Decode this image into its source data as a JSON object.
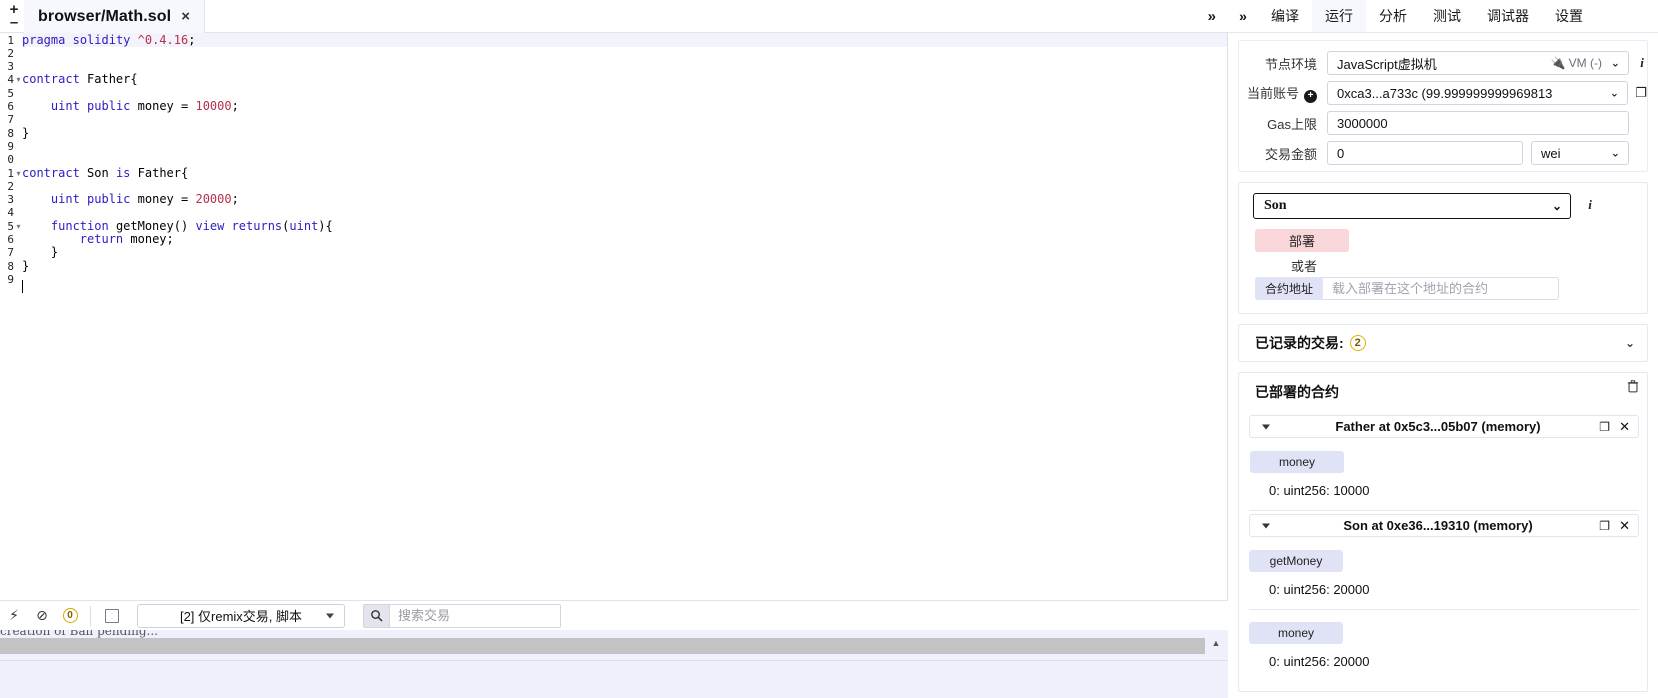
{
  "editor": {
    "tab_title": "browser/Math.sol",
    "tab_close": "×",
    "add_icon": "+",
    "minus_icon": "–",
    "expand_icon": "»",
    "line_numbers": [
      "1",
      "2",
      "3",
      "4",
      "5",
      "6",
      "7",
      "8",
      "9",
      "0",
      "1",
      "2",
      "3",
      "4",
      "5",
      "6",
      "7",
      "8",
      "9"
    ],
    "code_lines": [
      "pragma solidity ^0.4.16;",
      "",
      "",
      "contract Father{",
      "",
      "    uint public money = 10000;",
      "",
      "}",
      "",
      "",
      "contract Son is Father{",
      "",
      "    uint public money = 20000;",
      "",
      "    function getMoney() view returns(uint){",
      "        return money;",
      "    }",
      "}",
      ""
    ]
  },
  "bottom_toolbar": {
    "error_count": "0",
    "filter_label": "[2] 仅remix交易, 脚本",
    "search_placeholder": "搜索交易",
    "search_value": "",
    "checkbox_checked": false,
    "terminal_text": "creation of Ball pending..."
  },
  "right_panel": {
    "tabs": [
      {
        "label": "编译",
        "active": false
      },
      {
        "label": "运行",
        "active": true
      },
      {
        "label": "分析",
        "active": false
      },
      {
        "label": "测试",
        "active": false
      },
      {
        "label": "调试器",
        "active": false
      },
      {
        "label": "设置",
        "active": false
      }
    ],
    "expand_icon": "»",
    "environment": {
      "label": "节点环境",
      "value": "JavaScript虚拟机",
      "vm_tag": "VM (-)",
      "info_icon": "i"
    },
    "account": {
      "label": "当前账号",
      "value": "0xca3...a733c (99.999999999969813 ",
      "plus_icon": "+",
      "copy_icon": "❐"
    },
    "gas_limit": {
      "label": "Gas上限",
      "value": "3000000"
    },
    "value": {
      "label": "交易金额",
      "value": "0",
      "unit": "wei"
    },
    "deploy": {
      "contract_selected": "Son",
      "info_icon": "i",
      "deploy_label": "部署",
      "or_label": "或者",
      "at_address_label": "合约地址",
      "at_address_placeholder": "载入部署在这个地址的合约",
      "at_address_value": ""
    },
    "transactions": {
      "label": "已记录的交易:",
      "count": "2",
      "chevron": "∨"
    },
    "deployed": {
      "label": "已部署的合约",
      "trash_icon": "Ὕ1",
      "instances": [
        {
          "title": "Father at 0x5c3...05b07 (memory)",
          "copy_icon": "❐",
          "close_icon": "✕",
          "functions": [
            {
              "name": "money",
              "result": "0: uint256: 10000"
            }
          ]
        },
        {
          "title": "Son at 0xe36...19310 (memory)",
          "copy_icon": "❐",
          "close_icon": "✕",
          "functions": [
            {
              "name": "getMoney",
              "result": "0: uint256: 20000"
            },
            {
              "name": "money",
              "result": "0: uint256: 20000"
            }
          ]
        }
      ]
    }
  },
  "colors": {
    "accent_deploy": "#f9d6da",
    "fn_button": "#dfe3f5",
    "panel_bg": "#eef0fb",
    "keyword": "#2f20c2",
    "number": "#b5304b"
  }
}
